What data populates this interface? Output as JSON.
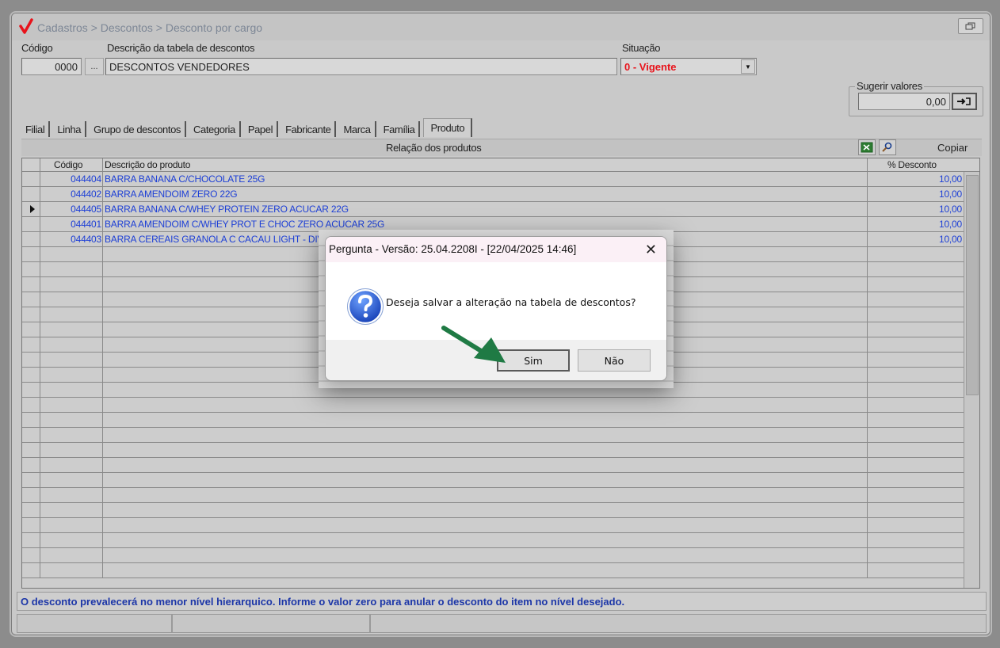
{
  "window": {
    "title": "Cadastros > Descontos > Desconto por cargo",
    "restore_icon": "restore-icon"
  },
  "form": {
    "codigo_label": "Código",
    "codigo_value": "0000",
    "ellipsis_label": "...",
    "descricao_label": "Descrição da tabela de descontos",
    "descricao_value": "DESCONTOS VENDEDORES",
    "situacao_label": "Situação",
    "situacao_value": "0 - Vigente",
    "situacao_color": "#e8131b",
    "sugerir_label": "Sugerir valores",
    "sugerir_value": "0,00"
  },
  "tabs": [
    {
      "label": "Filial"
    },
    {
      "label": "Linha"
    },
    {
      "label": "Grupo de descontos"
    },
    {
      "label": "Categoria"
    },
    {
      "label": "Papel"
    },
    {
      "label": "Fabricante"
    },
    {
      "label": "Marca"
    },
    {
      "label": "Família"
    },
    {
      "label": "Produto"
    }
  ],
  "active_tab": "Produto",
  "panel": {
    "title": "Relação dos produtos",
    "copy_label": "Copiar",
    "excel_icon": "excel-icon",
    "search_icon": "search-icon"
  },
  "grid": {
    "columns": [
      "Código",
      "Descrição do produto",
      "% Desconto"
    ],
    "rows": [
      {
        "codigo": "044404",
        "descricao": "BARRA BANANA C/CHOCOLATE 25G",
        "desconto": "10,00"
      },
      {
        "codigo": "044402",
        "descricao": "BARRA AMENDOIM ZERO 22G",
        "desconto": "10,00"
      },
      {
        "codigo": "044405",
        "descricao": "BARRA BANANA C/WHEY PROTEIN ZERO ACUCAR 22G",
        "desconto": "10,00"
      },
      {
        "codigo": "044401",
        "descricao": "BARRA AMENDOIM C/WHEY PROT E CHOC ZERO ACUCAR 25G",
        "desconto": "10,00"
      },
      {
        "codigo": "044403",
        "descricao": "BARRA CEREAIS GRANOLA C CACAU LIGHT - DIVERSOS",
        "desconto": "10,00"
      }
    ],
    "text_color": "#1d3fd6"
  },
  "info_bar": "O desconto prevalecerá no menor nível hierarquico. Informe o valor zero para anular o desconto do item no nível desejado.",
  "dialog": {
    "title": "Pergunta - Versão: 25.04.2208I - [22/04/2025 14:46]",
    "message": "Deseja salvar a alteração na tabela de descontos?",
    "yes_label": "Sim",
    "no_label": "Não",
    "close_glyph": "✕",
    "icon": "question-icon"
  },
  "annotation": {
    "arrow_color": "#1f7a44"
  }
}
